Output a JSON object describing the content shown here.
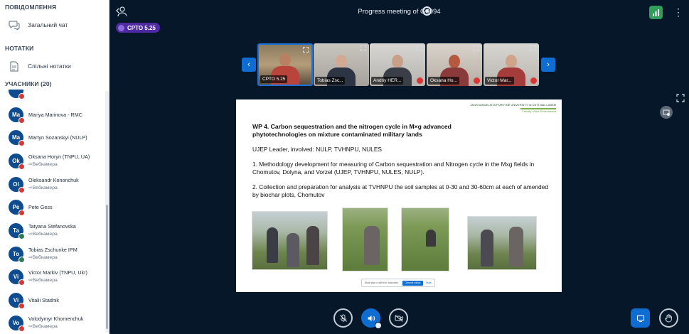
{
  "sidebar": {
    "messages_title": "ПОВІДОМЛЕННЯ",
    "public_chat": "Загальний чат",
    "notes_title": "НОТАТКИ",
    "shared_notes": "Спільні нотатки",
    "users_title": "УЧАСНИКИ (20)",
    "users": [
      {
        "initials": "Ma",
        "name": "Mariya Marinova - RMC",
        "sub": ""
      },
      {
        "initials": "Ma",
        "name": "Martyn Sozanskyi (NULP)",
        "sub": ""
      },
      {
        "initials": "Ok",
        "name": "Oksana Horyn (TNPU, UA)",
        "sub": "Вебкамера"
      },
      {
        "initials": "Ol",
        "name": "Oleksandr Kononchuk",
        "sub": "Вебкамера"
      },
      {
        "initials": "Pe",
        "name": "Pete Gess",
        "sub": ""
      },
      {
        "initials": "Ta",
        "name": "Tatyana Stefanovska",
        "sub": "Вебкамера"
      },
      {
        "initials": "To",
        "name": "Tobias Zschunke IPM",
        "sub": "Вебкамера"
      },
      {
        "initials": "Vi",
        "name": "Victor Markiv (TNPU, Ukr)",
        "sub": "Вебкамера"
      },
      {
        "initials": "Vi",
        "name": "Vitalii Stadnik",
        "sub": ""
      },
      {
        "initials": "Vo",
        "name": "Volodymyr Khomenchuk",
        "sub": "Вебкамера"
      }
    ]
  },
  "topbar": {
    "title": "Progress meeting of G6094",
    "talking": "CPTO 5.25"
  },
  "videos": [
    {
      "label": "CPTO 5.25"
    },
    {
      "label": "Tobias Zsc..."
    },
    {
      "label": "Andriy HER..."
    },
    {
      "label": "Oksana Ho..."
    },
    {
      "label": "Victor Mar..."
    }
  ],
  "slide": {
    "header_line1": "JAN EVANGELISTA PURKYNĚ UNIVERSITY IN ÚSTÍ NAD LABEM",
    "header_line2": "Faculty of the Environment",
    "title": "WP 4. Carbon sequestration and the nitrogen cycle in M×g advanced phytotechnologies on mixture contaminated military lands",
    "leader": "UJEP Leader, involved: NULP, TVHNPU, NULES",
    "item1": "1. Methodology development  for measuring of Carbon sequestration and Nitrogen cycle in the Mxg fields in Chomutov, Dolyna, and Vorzel (UJEP, TVHNPU, NULES, NULP).",
    "item2": "2. Collection and preparation for analysis at TVHNPU  the soil samples at 0-30 and 30-60cm at each  of amended by biochar plots, Chomutov"
  }
}
